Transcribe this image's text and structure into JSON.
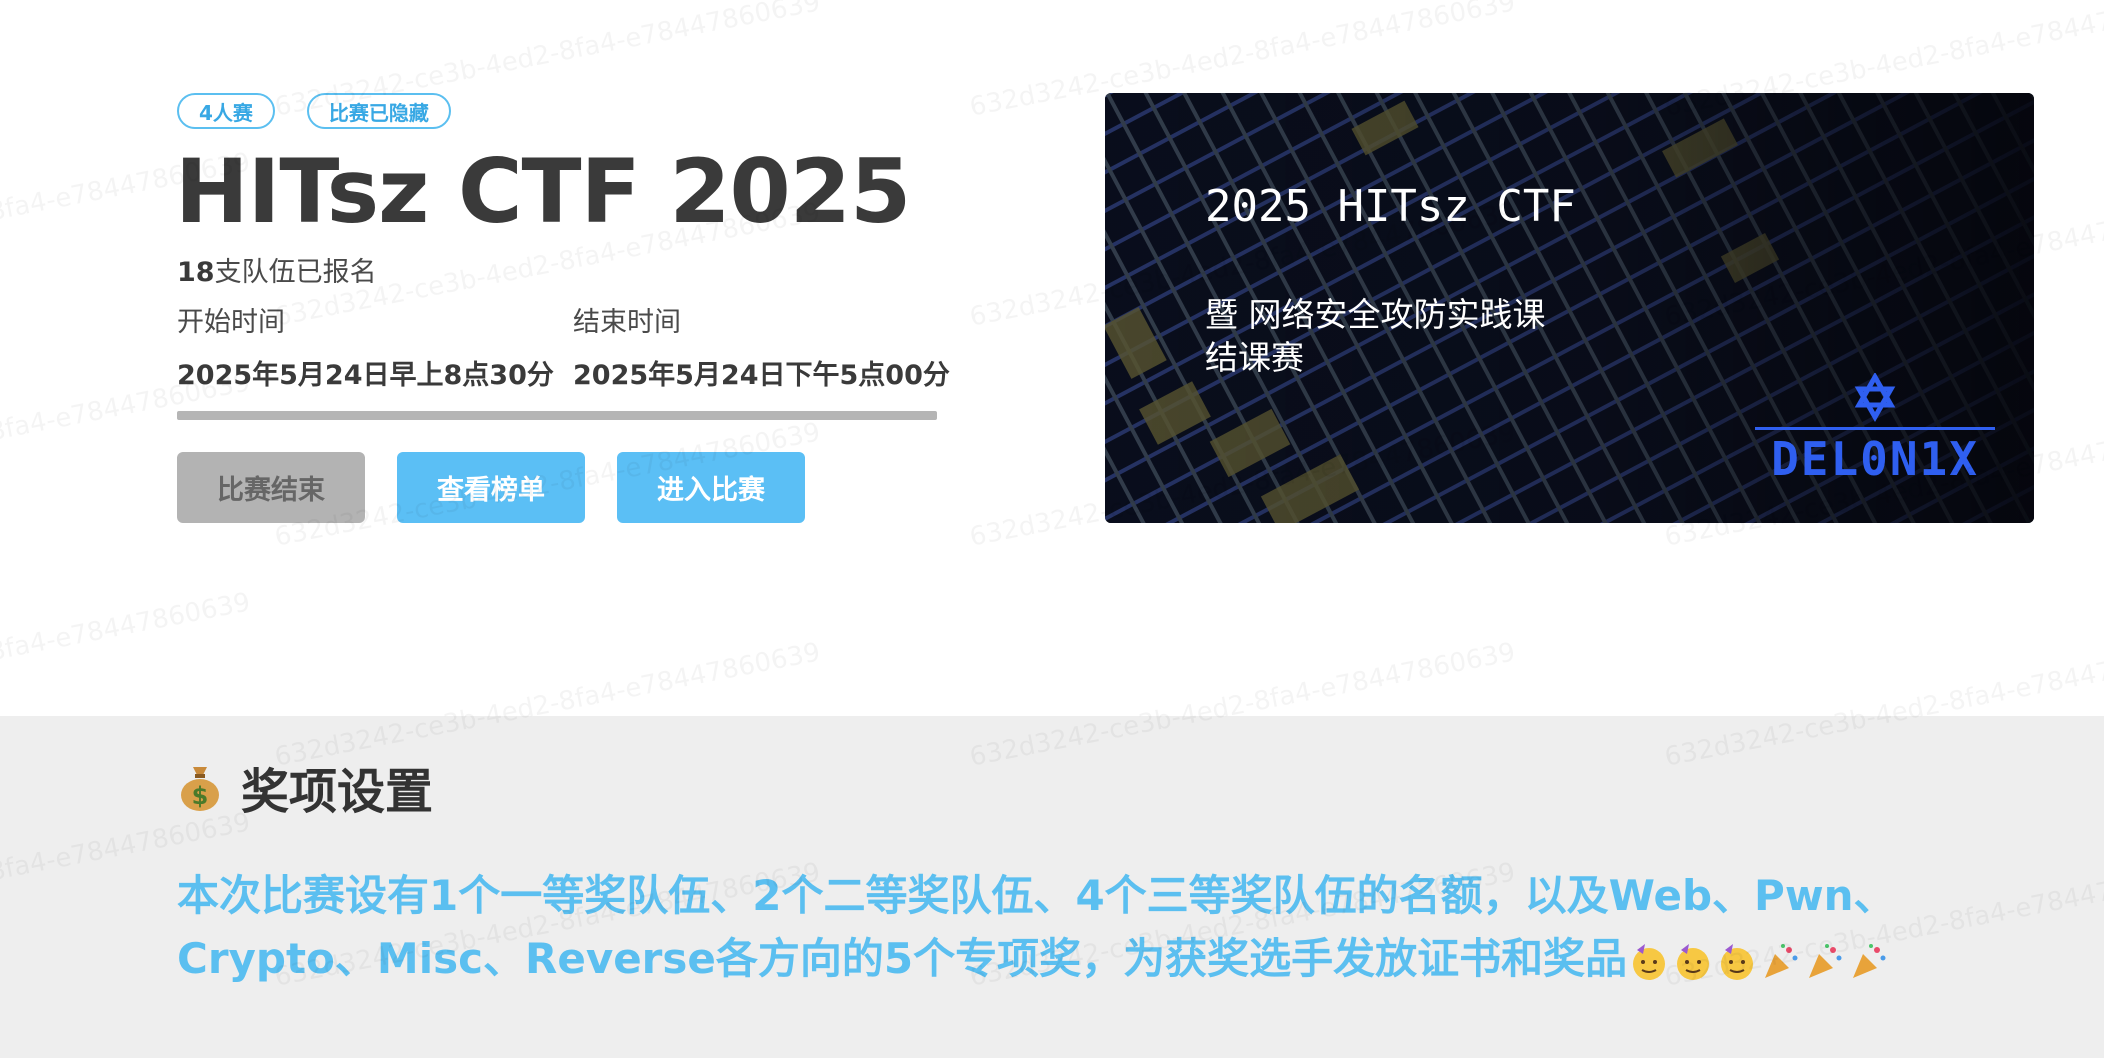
{
  "hero": {
    "tags": [
      "4人赛",
      "比赛已隐藏"
    ],
    "title": "HITsz CTF 2025",
    "registered_count": "18",
    "registered_suffix": "支队伍已报名",
    "start_label": "开始时间",
    "start_value": "2025年5月24日早上8点30分",
    "end_label": "结束时间",
    "end_value": "2025年5月24日下午5点00分",
    "progress": 1.0,
    "buttons": {
      "ended": "比赛结束",
      "leaderboard": "查看榜单",
      "enter": "进入比赛"
    }
  },
  "banner": {
    "title": "2025 HITsz CTF",
    "subtitle_line1": "暨 网络安全攻防实践课",
    "subtitle_line2": "结课赛",
    "logo_text": "DEL0N1X"
  },
  "prize": {
    "heading": "奖项设置",
    "icon": "money-bag-icon",
    "text": "本次比赛设有1个一等奖队伍、2个二等奖队伍、4个三等奖队伍的名额，以及Web、Pwn、Crypto、Misc、Reverse各方向的5个专项奖，为获奖选手发放证书和奖品",
    "emojis": [
      "partying-face-icon",
      "partying-face-icon",
      "partying-face-icon",
      "party-popper-icon",
      "party-popper-icon",
      "party-popper-icon"
    ]
  },
  "watermark": "632d3242-ce3b-4ed2-8fa4-e78447860639",
  "colors": {
    "accent": "#5bbff5",
    "ended": "#b3b3b3",
    "prize_bg": "#eeeeee",
    "logo_blue": "#2f5ff0"
  }
}
